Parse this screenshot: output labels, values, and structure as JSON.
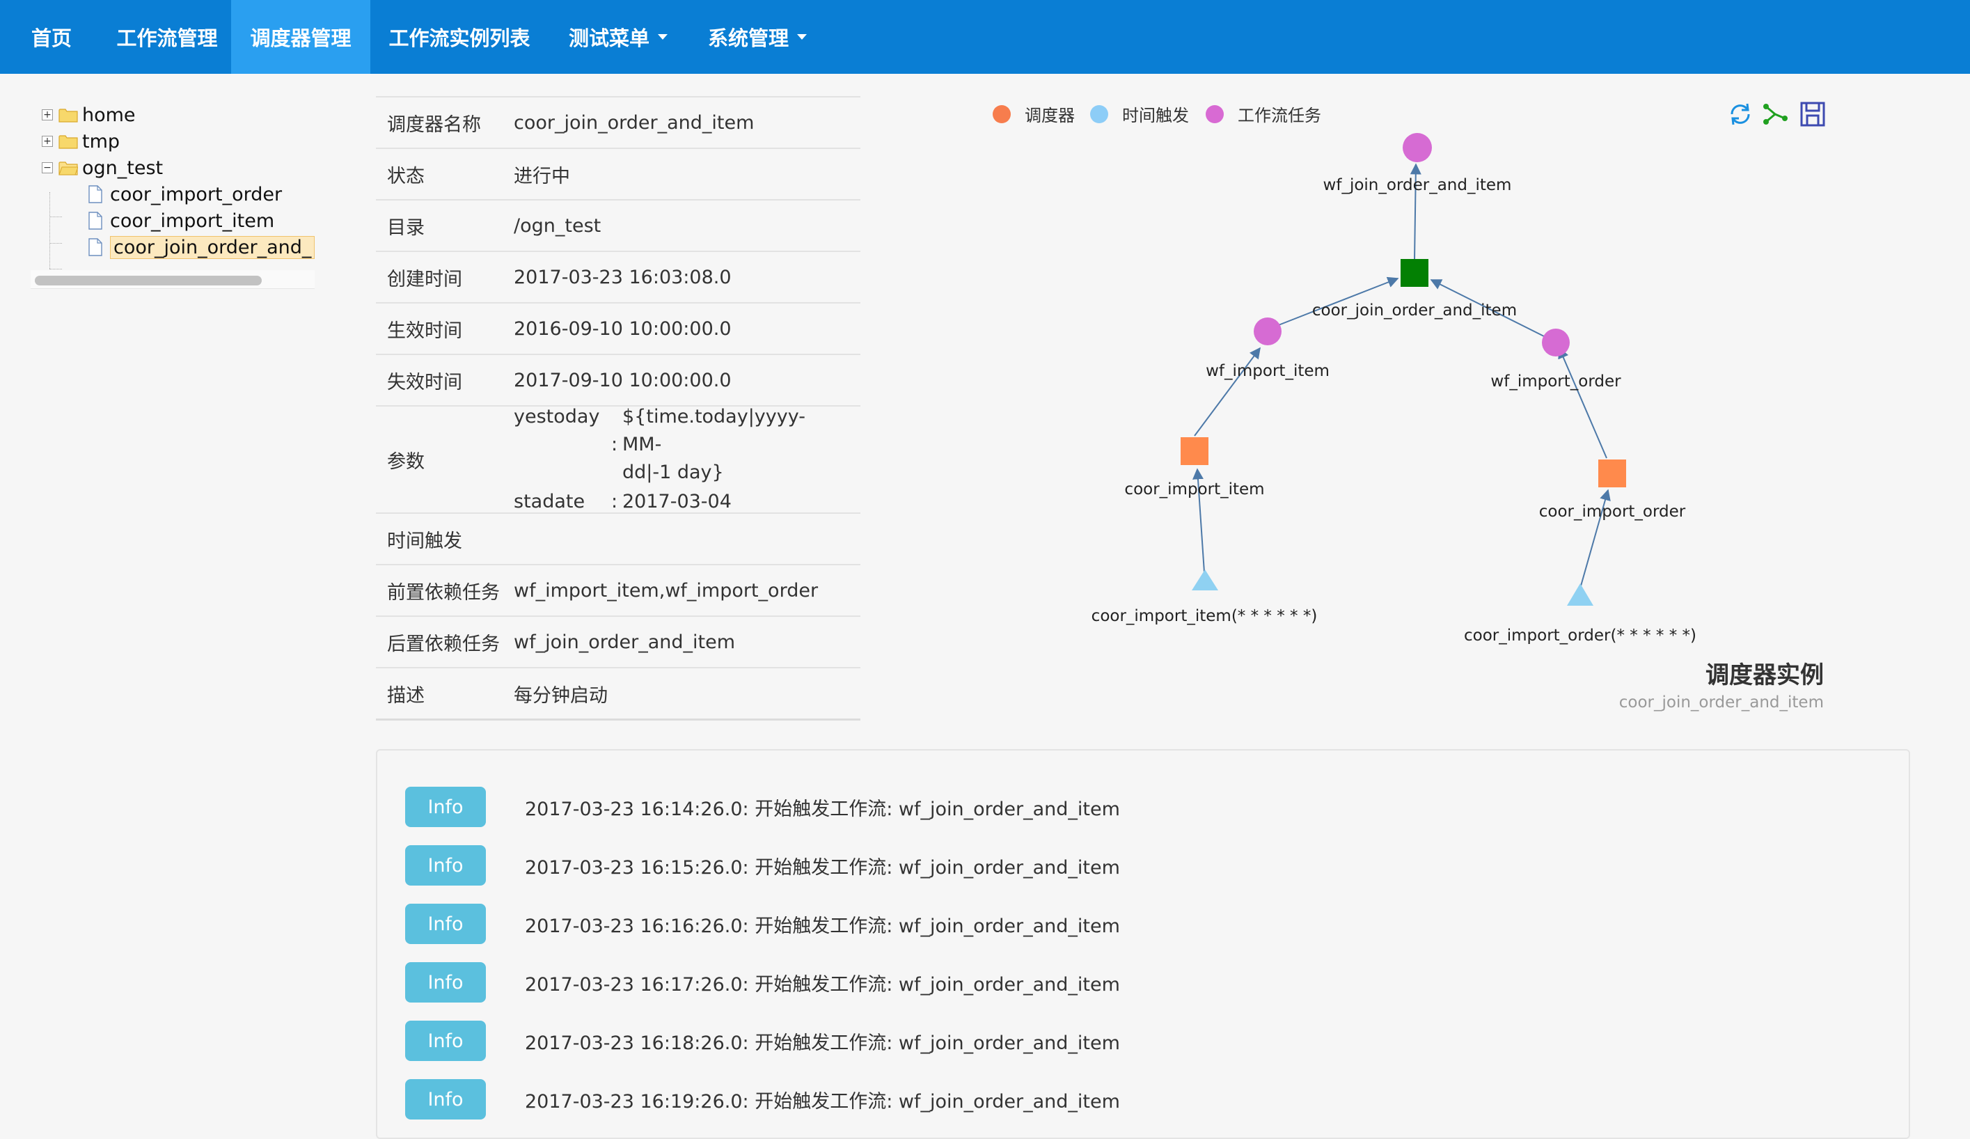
{
  "nav": {
    "items": [
      {
        "label": "首页"
      },
      {
        "label": "工作流管理"
      },
      {
        "label": "调度器管理"
      },
      {
        "label": "工作流实例列表"
      },
      {
        "label": "测试菜单"
      },
      {
        "label": "系统管理"
      }
    ]
  },
  "tree": {
    "home": "home",
    "tmp": "tmp",
    "ogn_test": "ogn_test",
    "files": [
      "coor_import_order",
      "coor_import_item",
      "coor_join_order_and_"
    ]
  },
  "props": {
    "name_key": "调度器名称",
    "name_val": "coor_join_order_and_item",
    "status_key": "状态",
    "status_val": "进行中",
    "dir_key": "目录",
    "dir_val": "/ogn_test",
    "created_key": "创建时间",
    "created_val": "2017-03-23 16:03:08.0",
    "effective_key": "生效时间",
    "effective_val": "2016-09-10 10:00:00.0",
    "expire_key": "失效时间",
    "expire_val": "2017-09-10 10:00:00.0",
    "params_key": "参数",
    "params": [
      {
        "name": "yestoday",
        "sep": ":",
        "value_line1": "${time.today|yyyy-MM-",
        "value_line2": "dd|-1 day}"
      },
      {
        "name": "stadate",
        "sep": ":",
        "value": "2017-03-04"
      }
    ],
    "trigger_key": "时间触发",
    "trigger_val": "",
    "pre_key": "前置依赖任务",
    "pre_val": "wf_import_item,wf_import_order",
    "post_key": "后置依赖任务",
    "post_val": "wf_join_order_and_item",
    "desc_key": "描述",
    "desc_val": "每分钟启动"
  },
  "graph": {
    "legend": [
      {
        "label": "调度器",
        "color": "#f77d4d"
      },
      {
        "label": "时间触发",
        "color": "#8dcdf7"
      },
      {
        "label": "工作流任务",
        "color": "#d86ad3"
      }
    ],
    "nodes": {
      "wf_join": "wf_join_order_and_item",
      "coor_join": "coor_join_order_and_item",
      "wf_item": "wf_import_item",
      "wf_order": "wf_import_order",
      "coor_item": "coor_import_item",
      "coor_order": "coor_import_order",
      "trig_item": "coor_import_item(* * * * * *)",
      "trig_order": "coor_import_order(* * * * * *)"
    },
    "colors": {
      "root": "#038003",
      "scheduler": "#ff8a4c",
      "trigger": "#8fd1f2",
      "workflow": "#d66bd3",
      "edge": "#4d79a8"
    },
    "title": "调度器实例",
    "subtitle": "coor_join_order_and_item"
  },
  "logs": [
    {
      "badge": "Info",
      "text": "2017-03-23 16:14:26.0: 开始触发工作流: wf_join_order_and_item"
    },
    {
      "badge": "Info",
      "text": "2017-03-23 16:15:26.0: 开始触发工作流: wf_join_order_and_item"
    },
    {
      "badge": "Info",
      "text": "2017-03-23 16:16:26.0: 开始触发工作流: wf_join_order_and_item"
    },
    {
      "badge": "Info",
      "text": "2017-03-23 16:17:26.0: 开始触发工作流: wf_join_order_and_item"
    },
    {
      "badge": "Info",
      "text": "2017-03-23 16:18:26.0: 开始触发工作流: wf_join_order_and_item"
    },
    {
      "badge": "Info",
      "text": "2017-03-23 16:19:26.0: 开始触发工作流: wf_join_order_and_item"
    }
  ]
}
